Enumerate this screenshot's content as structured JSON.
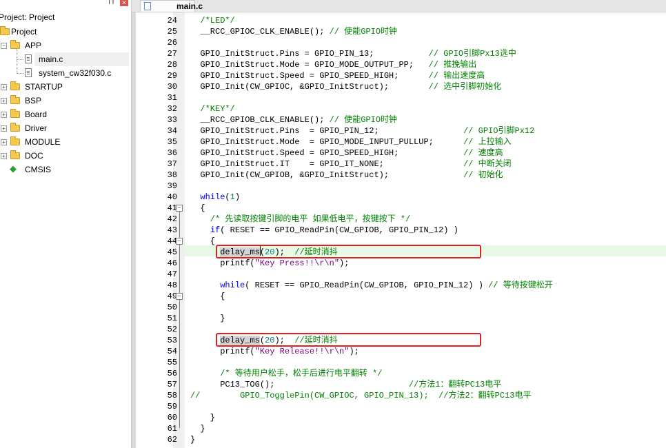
{
  "project_panel": {
    "title": "Project: Project",
    "pin_icon": "pin-icon",
    "close_icon": "close-icon",
    "root": "Project",
    "folders": [
      {
        "label": "APP",
        "expanded": true,
        "files": [
          "main.c",
          "system_cw32f030.c"
        ]
      },
      {
        "label": "STARTUP",
        "expanded": false
      },
      {
        "label": "BSP",
        "expanded": false
      },
      {
        "label": "Board",
        "expanded": false
      },
      {
        "label": "Driver",
        "expanded": false
      },
      {
        "label": "MODULE",
        "expanded": false
      },
      {
        "label": "DOC",
        "expanded": false
      },
      {
        "label": "CMSIS",
        "expanded": false
      }
    ],
    "selected_file": "main.c"
  },
  "editor": {
    "active_tab": "main.c",
    "current_line": 45,
    "colors": {
      "comment": "#008000",
      "keyword": "#0000ff",
      "number": "#008080",
      "string": "#800080",
      "annotation_box": "#e02020"
    },
    "lines": [
      {
        "n": "24",
        "parts": [
          {
            "t": "  ",
            "c": ""
          },
          {
            "t": "/*LED*/",
            "c": "cmt"
          }
        ]
      },
      {
        "n": "25",
        "parts": [
          {
            "t": "  __RCC_GPIOC_CLK_ENABLE(); ",
            "c": ""
          },
          {
            "t": "// 使能GPIO时钟",
            "c": "cmt"
          }
        ]
      },
      {
        "n": "26",
        "parts": []
      },
      {
        "n": "27",
        "parts": [
          {
            "t": "  GPIO_InitStruct.Pins = GPIO_PIN_13;           ",
            "c": ""
          },
          {
            "t": "// GPIO引脚Px13选中",
            "c": "cmt"
          }
        ]
      },
      {
        "n": "28",
        "parts": [
          {
            "t": "  GPIO_InitStruct.Mode = GPIO_MODE_OUTPUT_PP;   ",
            "c": ""
          },
          {
            "t": "// 推挽输出",
            "c": "cmt"
          }
        ]
      },
      {
        "n": "29",
        "parts": [
          {
            "t": "  GPIO_InitStruct.Speed = GPIO_SPEED_HIGH;      ",
            "c": ""
          },
          {
            "t": "// 输出速度高",
            "c": "cmt"
          }
        ]
      },
      {
        "n": "30",
        "parts": [
          {
            "t": "  GPIO_Init(CW_GPIOC, &GPIO_InitStruct);        ",
            "c": ""
          },
          {
            "t": "// 选中引脚初始化",
            "c": "cmt"
          }
        ]
      },
      {
        "n": "31",
        "parts": []
      },
      {
        "n": "32",
        "parts": [
          {
            "t": "  ",
            "c": ""
          },
          {
            "t": "/*KEY*/",
            "c": "cmt"
          }
        ]
      },
      {
        "n": "33",
        "parts": [
          {
            "t": "  __RCC_GPIOB_CLK_ENABLE(); ",
            "c": ""
          },
          {
            "t": "// 使能GPIO时钟",
            "c": "cmt"
          }
        ]
      },
      {
        "n": "34",
        "parts": [
          {
            "t": "  GPIO_InitStruct.Pins  = GPIO_PIN_12;                 ",
            "c": ""
          },
          {
            "t": "// GPIO引脚Px12",
            "c": "cmt"
          }
        ]
      },
      {
        "n": "35",
        "parts": [
          {
            "t": "  GPIO_InitStruct.Mode  = GPIO_MODE_INPUT_PULLUP;      ",
            "c": ""
          },
          {
            "t": "// 上拉输入",
            "c": "cmt"
          }
        ]
      },
      {
        "n": "36",
        "parts": [
          {
            "t": "  GPIO_InitStruct.Speed = GPIO_SPEED_HIGH;             ",
            "c": ""
          },
          {
            "t": "// 速度高",
            "c": "cmt"
          }
        ]
      },
      {
        "n": "37",
        "parts": [
          {
            "t": "  GPIO_InitStruct.IT    = GPIO_IT_NONE;                ",
            "c": ""
          },
          {
            "t": "// 中断关闭",
            "c": "cmt"
          }
        ]
      },
      {
        "n": "38",
        "parts": [
          {
            "t": "  GPIO_Init(CW_GPIOB, &GPIO_InitStruct);               ",
            "c": ""
          },
          {
            "t": "// 初始化",
            "c": "cmt"
          }
        ]
      },
      {
        "n": "39",
        "parts": []
      },
      {
        "n": "40",
        "parts": [
          {
            "t": "  ",
            "c": ""
          },
          {
            "t": "while",
            "c": "kw"
          },
          {
            "t": "(",
            "c": ""
          },
          {
            "t": "1",
            "c": "num"
          },
          {
            "t": ")",
            "c": ""
          }
        ]
      },
      {
        "n": "41",
        "parts": [
          {
            "t": "  {",
            "c": ""
          }
        ]
      },
      {
        "n": "42",
        "parts": [
          {
            "t": "    ",
            "c": ""
          },
          {
            "t": "/* 先读取按键引脚的电平 如果低电平，按键按下 */",
            "c": "cmt"
          }
        ]
      },
      {
        "n": "43",
        "parts": [
          {
            "t": "    ",
            "c": ""
          },
          {
            "t": "if",
            "c": "kw"
          },
          {
            "t": "( RESET == GPIO_ReadPin(CW_GPIOB, GPIO_PIN_12) )",
            "c": ""
          }
        ]
      },
      {
        "n": "44",
        "parts": [
          {
            "t": "    {",
            "c": ""
          }
        ]
      },
      {
        "n": "45",
        "parts": [
          {
            "t": "      ",
            "c": ""
          },
          {
            "t": "delay_ms",
            "c": "hl"
          },
          {
            "t": "(",
            "c": ""
          },
          {
            "t": "20",
            "c": "num"
          },
          {
            "t": ");  ",
            "c": ""
          },
          {
            "t": "//延时消抖",
            "c": "cmt"
          }
        ]
      },
      {
        "n": "46",
        "parts": [
          {
            "t": "      printf(",
            "c": ""
          },
          {
            "t": "\"Key Press!!\\r\\n\"",
            "c": "str"
          },
          {
            "t": ");",
            "c": ""
          }
        ]
      },
      {
        "n": "47",
        "parts": []
      },
      {
        "n": "48",
        "parts": [
          {
            "t": "      ",
            "c": ""
          },
          {
            "t": "while",
            "c": "kw"
          },
          {
            "t": "( RESET == GPIO_ReadPin(CW_GPIOB, GPIO_PIN_12) ) ",
            "c": ""
          },
          {
            "t": "// 等待按键松开",
            "c": "cmt"
          }
        ]
      },
      {
        "n": "49",
        "parts": [
          {
            "t": "      {",
            "c": ""
          }
        ]
      },
      {
        "n": "50",
        "parts": []
      },
      {
        "n": "51",
        "parts": [
          {
            "t": "      }",
            "c": ""
          }
        ]
      },
      {
        "n": "52",
        "parts": []
      },
      {
        "n": "53",
        "parts": [
          {
            "t": "      ",
            "c": ""
          },
          {
            "t": "delay_ms",
            "c": "hl"
          },
          {
            "t": "(",
            "c": ""
          },
          {
            "t": "20",
            "c": "num"
          },
          {
            "t": ");  ",
            "c": ""
          },
          {
            "t": "//延时消抖",
            "c": "cmt"
          }
        ]
      },
      {
        "n": "54",
        "parts": [
          {
            "t": "      printf(",
            "c": ""
          },
          {
            "t": "\"Key Release!!\\r\\n\"",
            "c": "str"
          },
          {
            "t": ");",
            "c": ""
          }
        ]
      },
      {
        "n": "55",
        "parts": []
      },
      {
        "n": "56",
        "parts": [
          {
            "t": "      ",
            "c": ""
          },
          {
            "t": "/* 等待用户松手，松手后进行电平翻转 */",
            "c": "cmt"
          }
        ]
      },
      {
        "n": "57",
        "parts": [
          {
            "t": "      PC13_TOG();                           ",
            "c": ""
          },
          {
            "t": "//方法1：翻转PC13电平",
            "c": "cmt"
          }
        ]
      },
      {
        "n": "58",
        "parts": [
          {
            "t": "//        GPIO_TogglePin(CW_GPIOC, GPIO_PIN_13);  //方法2：翻转PC13电平",
            "c": "cmt"
          }
        ]
      },
      {
        "n": "59",
        "parts": []
      },
      {
        "n": "60",
        "parts": [
          {
            "t": "    }",
            "c": ""
          }
        ]
      },
      {
        "n": "61",
        "parts": [
          {
            "t": "  }",
            "c": ""
          }
        ]
      },
      {
        "n": "62",
        "parts": [
          {
            "t": "}",
            "c": ""
          }
        ]
      }
    ]
  }
}
